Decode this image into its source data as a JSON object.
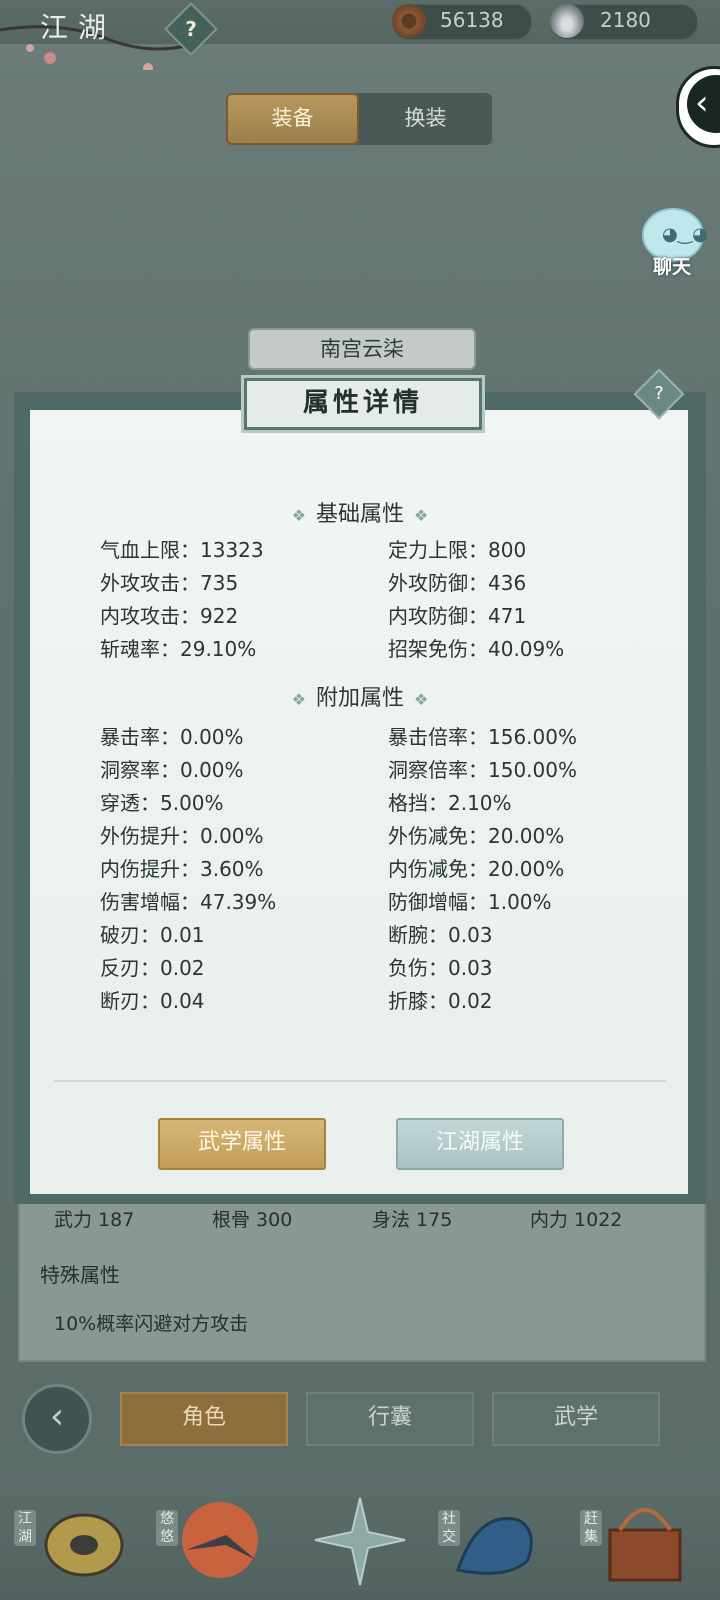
{
  "header": {
    "title": "江湖",
    "coins": "56138",
    "silver": "2180"
  },
  "tabs": {
    "equip": "装备",
    "swap": "换装"
  },
  "chat": {
    "label": "聊天"
  },
  "character": {
    "name": "南宫云柒"
  },
  "modal": {
    "title": "属性详情",
    "help": "?",
    "basic_title": "基础属性",
    "basic": [
      "气血上限：13323",
      "定力上限：800",
      "外攻攻击：735",
      "外攻防御：436",
      "内攻攻击：922",
      "内攻防御：471",
      "斩魂率：29.10%",
      "招架免伤：40.09%"
    ],
    "extra_title": "附加属性",
    "extra": [
      "暴击率：0.00%",
      "暴击倍率：156.00%",
      "洞察率：0.00%",
      "洞察倍率：150.00%",
      "穿透：5.00%",
      "格挡：2.10%",
      "外伤提升：0.00%",
      "外伤减免：20.00%",
      "内伤提升：3.60%",
      "内伤减免：20.00%",
      "伤害增幅：47.39%",
      "防御增幅：1.00%",
      "破刃：0.01",
      "断腕：0.03",
      "反刃：0.02",
      "负伤：0.03",
      "断刃：0.04",
      "折膝：0.02"
    ],
    "btn_martial": "武学属性",
    "btn_jianghu": "江湖属性"
  },
  "stats": {
    "wuli": "武力 187",
    "gengu": "根骨 300",
    "shenfa": "身法 175",
    "neili": "内力 1022"
  },
  "special": {
    "title": "特殊属性",
    "text": "10%概率闪避对方攻击"
  },
  "bottom_nav": {
    "role": "角色",
    "bag": "行囊",
    "martial": "武学"
  },
  "dock": {
    "jianghu": "江湖",
    "youyou": "悠悠",
    "social": "社交",
    "market": "赶集"
  }
}
